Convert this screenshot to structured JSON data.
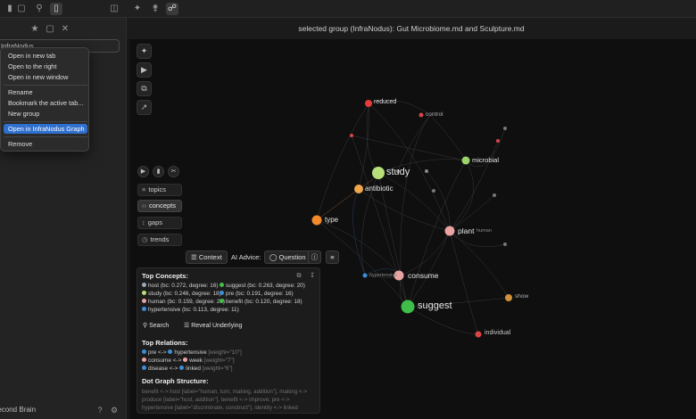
{
  "window": {
    "pane_title": "selected group (InfraNodus): Gut Microbiome.md and Sculpture.md"
  },
  "topbar": {
    "icons": [
      "sidebar-toggle-icon",
      "folder-icon",
      "search-icon",
      "bookmark-icon",
      "layout-icon",
      "wand-icon",
      "graph-icon",
      "network-icon"
    ]
  },
  "sidebar": {
    "field_value": "InfraNodus",
    "vault_name": "Second Brain",
    "footer_icons": [
      "help-icon",
      "gear-icon"
    ]
  },
  "context_menu": {
    "items": [
      "Open in new tab",
      "Open to the right",
      "Open in new window",
      "Rename",
      "Bookmark the active tab...",
      "New group",
      "Open in InfraNodus Graph",
      "Remove"
    ],
    "selected": "Open in InfraNodus Graph"
  },
  "graph": {
    "nav": {
      "topics": "topics",
      "concepts": "concepts",
      "gaps": "gaps",
      "trends": "trends"
    },
    "context_label": "Context",
    "ai_advice_label": "AI Advice:",
    "question_label": "Question",
    "panel": {
      "top_concepts_title": "Top Concepts:",
      "concepts": [
        {
          "text": "host (bc: 0.272, degree: 16)",
          "color": "#9aa8b8"
        },
        {
          "text": "suggest (bc: 0.263, degree: 20)",
          "color": "#3fbf4a"
        },
        {
          "text": "study (bc: 0.246, degree: 18)",
          "color": "#b8e07a"
        },
        {
          "text": "pre (bc: 0.191, degree: 16)",
          "color": "#3b8ed8"
        },
        {
          "text": "human (bc: 0.159, degree: 29)",
          "color": "#e9a3a3"
        },
        {
          "text": "benefit (bc: 0.120, degree: 18)",
          "color": "#3fbf4a"
        },
        {
          "text": "hypertensive (bc: 0.113, degree: 11)",
          "color": "#3b8ed8"
        }
      ],
      "search_label": "Search",
      "reveal_label": "Reveal Underlying",
      "top_relations_title": "Top Relations:",
      "relations": [
        {
          "a": "pre",
          "b": "hypertensive",
          "w": "[weight=\"10\"]",
          "ca": "#3b8ed8",
          "cb": "#3b8ed8"
        },
        {
          "a": "consume",
          "b": "week",
          "w": "[weight=\"7\"]",
          "ca": "#e9a3a3",
          "cb": "#e9a3a3"
        },
        {
          "a": "disease",
          "b": "linked",
          "w": "[weight=\"6\"]",
          "ca": "#3b8ed8",
          "cb": "#3b8ed8"
        }
      ],
      "dot_title": "Dot Graph Structure:",
      "dot_text": "benefit <-> host [label=\"human, turn, making, addition\"], making <-> produce [label=\"host, addition\"], benefit <-> improve; pre <-> hypertensive [label=\"discriminate, construct\"], identity <-> linked"
    },
    "nodes": [
      {
        "label": "reduced",
        "color": "#e53b3b"
      },
      {
        "label": "control",
        "color": "#d94646"
      },
      {
        "label": "study",
        "color": "#b8e07a"
      },
      {
        "label": "microbial",
        "color": "#9ed36a"
      },
      {
        "label": "antibiotic",
        "color": "#f0a64a"
      },
      {
        "label": "type",
        "color": "#f08a2a"
      },
      {
        "label": "plant",
        "color": "#e9a3a3"
      },
      {
        "label": "human",
        "color": "#e9a3a3"
      },
      {
        "label": "consume",
        "color": "#e9a3a3"
      },
      {
        "label": "hypertensive",
        "color": "#3b8ed8"
      },
      {
        "label": "suggest",
        "color": "#3fbf4a"
      },
      {
        "label": "show",
        "color": "#d0913a"
      },
      {
        "label": "individual",
        "color": "#d94646"
      }
    ]
  }
}
